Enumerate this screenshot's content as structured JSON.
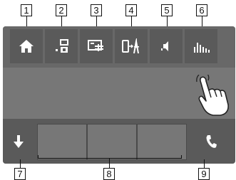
{
  "callouts": {
    "c1": "1",
    "c2": "2",
    "c3": "3",
    "c4": "4",
    "c5": "5",
    "c6": "6",
    "c7": "7",
    "c8": "8",
    "c9": "9"
  },
  "top_bar": {
    "icons": [
      "home-icon",
      "source-select-icon",
      "display-settings-icon",
      "mirroring-icon",
      "audio-icon",
      "equalizer-icon"
    ]
  },
  "bottom_bar": {
    "left_icon": "arrow-down-icon",
    "right_icon": "phone-icon",
    "favorite_slots": 3
  },
  "colors": {
    "screen": "#777777",
    "bar": "#5a5a5a",
    "icon": "#ffffff"
  }
}
